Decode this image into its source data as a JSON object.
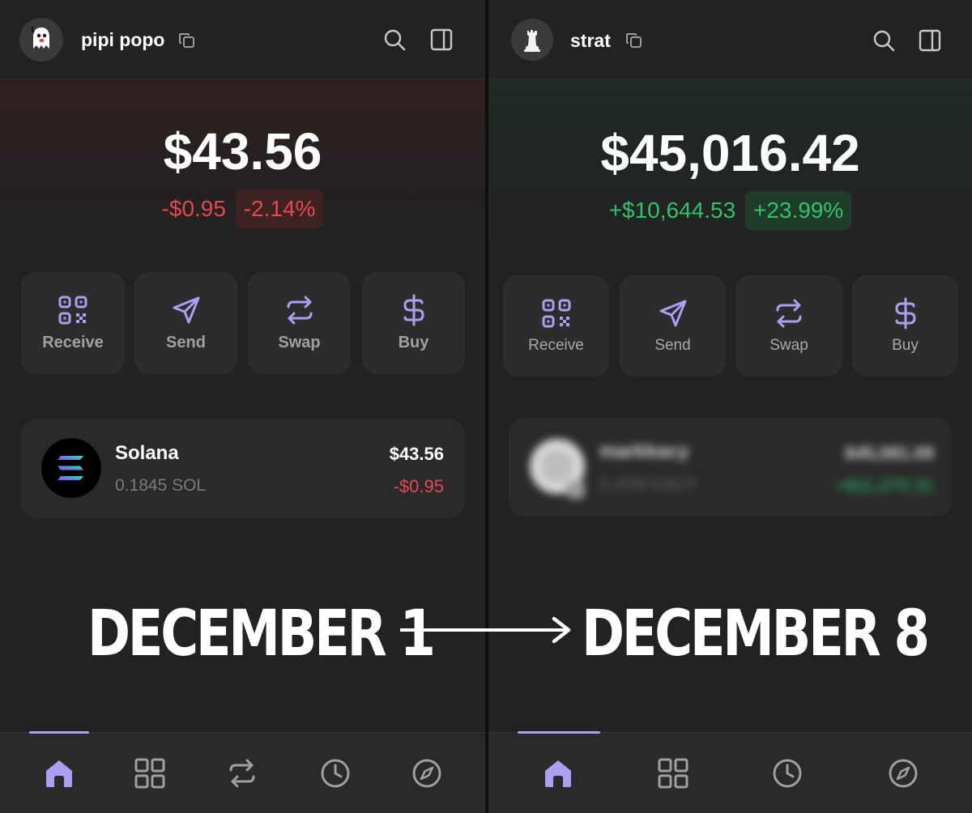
{
  "left": {
    "account_name": "pipi popo",
    "balance": "$43.56",
    "change_abs": "-$0.95",
    "change_pct": "-2.14%",
    "actions": [
      "Receive",
      "Send",
      "Swap",
      "Buy"
    ],
    "token": {
      "name": "Solana",
      "amount": "0.1845 SOL",
      "usd": "$43.56",
      "change": "-$0.95"
    },
    "nav": [
      "home-icon",
      "grid-icon",
      "swap-icon",
      "clock-icon",
      "compass-icon"
    ]
  },
  "right": {
    "account_name": "strat",
    "balance": "$45,016.42",
    "change_abs": "+$10,644.53",
    "change_pct": "+23.99%",
    "actions": [
      "Receive",
      "Send",
      "Swap",
      "Buy"
    ],
    "token": {
      "name": "markkacy",
      "amount": "5.37M KACY",
      "usd": "$45,081.09",
      "change": "+$11,070.31"
    },
    "nav": [
      "home-icon",
      "grid-icon",
      "clock-icon",
      "compass-icon"
    ]
  },
  "captions": {
    "from": "DECEMBER 1",
    "to": "DECEMBER 8"
  },
  "colors": {
    "accent": "#ab9ff2",
    "negative": "#e5484d",
    "positive": "#30c26b",
    "background": "#222222"
  }
}
